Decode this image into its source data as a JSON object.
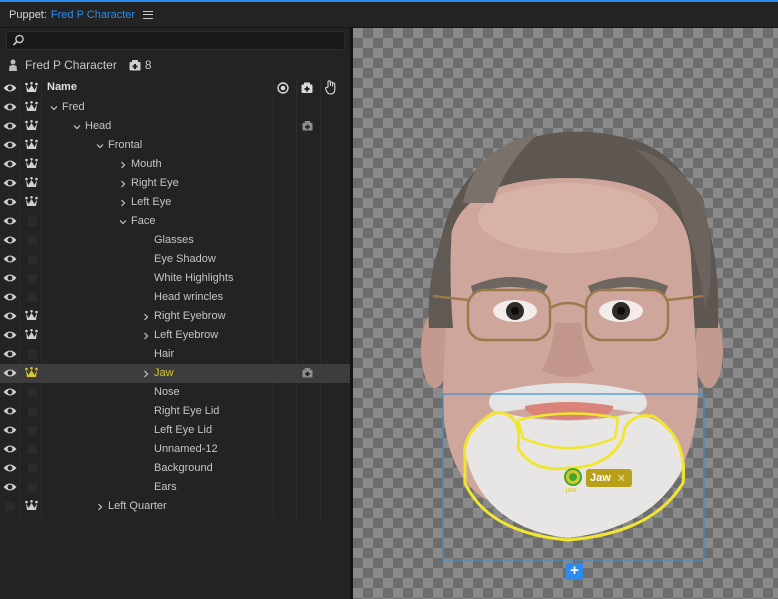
{
  "title": {
    "label": "Puppet:",
    "name": "Fred P Character"
  },
  "search": {
    "placeholder": ""
  },
  "puppet": {
    "name": "Fred P Character",
    "rig_count": "8"
  },
  "columns": {
    "name": "Name"
  },
  "colors": {
    "accent": "#2d8ceb",
    "selected_text": "#d7c728",
    "handle": "#40a832"
  },
  "rows": [
    {
      "label": "Fred",
      "indent": 1,
      "chevron": "down",
      "eye": true,
      "crown": true
    },
    {
      "label": "Head",
      "indent": 2,
      "chevron": "down",
      "eye": true,
      "crown": true,
      "cam": true
    },
    {
      "label": "Frontal",
      "indent": 3,
      "chevron": "down",
      "eye": true,
      "crown": true
    },
    {
      "label": "Mouth",
      "indent": 4,
      "chevron": "right",
      "eye": true,
      "crown": true
    },
    {
      "label": "Right Eye",
      "indent": 4,
      "chevron": "right",
      "eye": true,
      "crown": true
    },
    {
      "label": "Left Eye",
      "indent": 4,
      "chevron": "right",
      "eye": true,
      "crown": true
    },
    {
      "label": "Face",
      "indent": 4,
      "chevron": "down",
      "eye": true,
      "crown": false
    },
    {
      "label": "Glasses",
      "indent": 5,
      "chevron": "",
      "eye": true,
      "crown": false
    },
    {
      "label": "Eye Shadow",
      "indent": 5,
      "chevron": "",
      "eye": true,
      "crown": false
    },
    {
      "label": "White Highlights",
      "indent": 5,
      "chevron": "",
      "eye": true,
      "crown": false
    },
    {
      "label": "Head wrincles",
      "indent": 5,
      "chevron": "",
      "eye": true,
      "crown": false
    },
    {
      "label": "Right Eyebrow",
      "indent": 5,
      "chevron": "right",
      "eye": true,
      "crown": true
    },
    {
      "label": "Left Eyebrow",
      "indent": 5,
      "chevron": "right",
      "eye": true,
      "crown": true
    },
    {
      "label": "Hair",
      "indent": 5,
      "chevron": "",
      "eye": true,
      "crown": false
    },
    {
      "label": "Jaw",
      "indent": 5,
      "chevron": "right",
      "eye": true,
      "crown": true,
      "selected": true,
      "cam": true
    },
    {
      "label": "Nose",
      "indent": 5,
      "chevron": "",
      "eye": true,
      "crown": false
    },
    {
      "label": "Right Eye Lid",
      "indent": 5,
      "chevron": "",
      "eye": true,
      "crown": false
    },
    {
      "label": "Left Eye Lid",
      "indent": 5,
      "chevron": "",
      "eye": true,
      "crown": false
    },
    {
      "label": "Unnamed-12",
      "indent": 5,
      "chevron": "",
      "eye": true,
      "crown": false
    },
    {
      "label": "Background",
      "indent": 5,
      "chevron": "",
      "eye": true,
      "crown": false
    },
    {
      "label": "Ears",
      "indent": 5,
      "chevron": "",
      "eye": true,
      "crown": false
    },
    {
      "label": "Left Quarter",
      "indent": 3,
      "chevron": "right",
      "eye": false,
      "crown": true
    }
  ],
  "stage": {
    "handle_tag": "Jaw",
    "handle_small": "jaw",
    "close": "✕",
    "add": "+"
  }
}
